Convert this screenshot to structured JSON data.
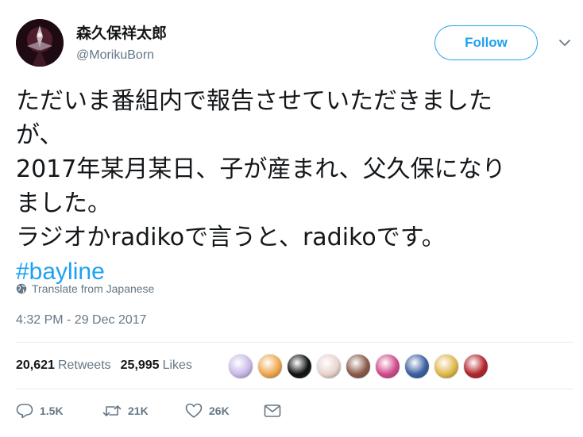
{
  "user": {
    "display_name": "森久保祥太郎",
    "handle": "@MorikuBorn"
  },
  "follow_label": "Follow",
  "tweet": {
    "lines": [
      "ただいま番組内で報告させていただきました",
      "が、",
      "2017年某月某日、子が産まれ、父久保になり",
      "ました。",
      "ラジオかradikoで言うと、radikoです。"
    ],
    "hashtag": "#bayline"
  },
  "translate_label": "Translate from Japanese",
  "timestamp": "4:32 PM - 29 Dec 2017",
  "stats": {
    "retweets_count": "20,621",
    "retweets_label": "Retweets",
    "likes_count": "25,995",
    "likes_label": "Likes"
  },
  "likers": [
    {
      "color": "#c9b9e8"
    },
    {
      "color": "#f0a64b"
    },
    {
      "color": "#111111"
    },
    {
      "color": "#e8d3cc"
    },
    {
      "color": "#8a5a4a"
    },
    {
      "color": "#d24a8a"
    },
    {
      "color": "#3a5fa0"
    },
    {
      "color": "#e0b84a"
    },
    {
      "color": "#b3242b"
    }
  ],
  "actions": {
    "reply_count": "1.5K",
    "retweet_count": "21K",
    "like_count": "26K"
  },
  "colors": {
    "accent": "#1da1f2",
    "secondary_text": "#657786",
    "divider": "#e6ecf0"
  }
}
